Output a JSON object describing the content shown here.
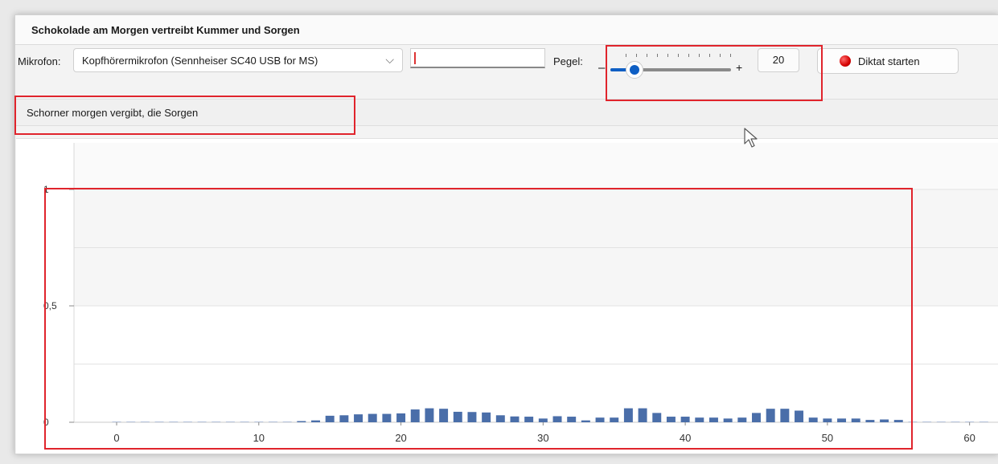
{
  "window": {
    "title": "Schokolade am Morgen vertreibt Kummer und Sorgen"
  },
  "toolbar": {
    "mic_label": "Mikrofon:",
    "mic_value": "Kopfhörermikrofon (Sennheiser SC40 USB for MS)",
    "level_label": "Pegel:",
    "slider_minus": "–",
    "slider_plus": "+",
    "slider_value": 20,
    "slider_max": 100,
    "value_text": "20",
    "dictate_label": "Diktat starten"
  },
  "result": {
    "text": "Schorner morgen vergibt, die Sorgen"
  },
  "colors": {
    "bar": "#4a6ea9",
    "accent": "#0f5fc4",
    "highlight": "#e0242c",
    "record": "#d40000"
  },
  "chart_data": {
    "type": "bar",
    "xlim": [
      -3,
      62
    ],
    "ylim": [
      0,
      1.2
    ],
    "xticks": [
      "0",
      "10",
      "20",
      "30",
      "40",
      "50",
      "60"
    ],
    "yticks": [
      "0",
      "0,5",
      "1"
    ],
    "x": [
      0,
      1,
      2,
      3,
      4,
      5,
      6,
      7,
      8,
      9,
      10,
      11,
      12,
      13,
      14,
      15,
      16,
      17,
      18,
      19,
      20,
      21,
      22,
      23,
      24,
      25,
      26,
      27,
      28,
      29,
      30,
      31,
      32,
      33,
      34,
      35,
      36,
      37,
      38,
      39,
      40,
      41,
      42,
      43,
      44,
      45,
      46,
      47,
      48,
      49,
      50,
      51,
      52,
      53,
      54,
      55,
      56,
      57,
      58,
      59,
      60,
      61
    ],
    "values": [
      0.003,
      0.003,
      0.003,
      0.003,
      0.003,
      0.003,
      0.003,
      0.003,
      0.003,
      0.003,
      0.003,
      0.003,
      0.003,
      0.005,
      0.008,
      0.028,
      0.03,
      0.034,
      0.036,
      0.036,
      0.038,
      0.055,
      0.06,
      0.058,
      0.045,
      0.044,
      0.042,
      0.03,
      0.025,
      0.024,
      0.016,
      0.026,
      0.024,
      0.008,
      0.02,
      0.02,
      0.06,
      0.06,
      0.04,
      0.024,
      0.024,
      0.02,
      0.02,
      0.016,
      0.02,
      0.04,
      0.058,
      0.058,
      0.05,
      0.02,
      0.016,
      0.016,
      0.016,
      0.01,
      0.012,
      0.01,
      0.003,
      0.003,
      0.003,
      0.003,
      0.003,
      0.003
    ]
  }
}
